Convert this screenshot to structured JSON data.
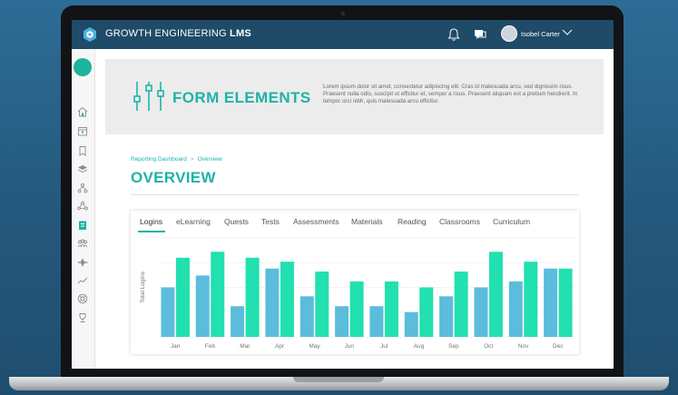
{
  "header": {
    "title_main": "GROWTH ENGINEERING",
    "title_bold": "LMS",
    "user_name": "Isobel Carter"
  },
  "icons": {
    "logo": "hexagon-logo-icon",
    "notifications": "bell-icon",
    "messages": "chat-icon",
    "user_menu": "chevron-down-icon",
    "sidebar": [
      "home-icon",
      "calendar-icon",
      "bookmark-icon",
      "layers-icon",
      "hierarchy-icon",
      "network-icon",
      "clipboard-icon",
      "group-icon",
      "compass-icon",
      "trend-icon",
      "lifebuoy-icon",
      "trophy-icon"
    ]
  },
  "banner": {
    "title": "FORM ELEMENTS",
    "description": "Lorem ipsum dolor sit amet, consectetur adipiscing elit. Cras id malesuada arcu, sed dignissim risus. Praesent nulla odio, suscipit ut efficitur et, semper a risus. Praesent aliquam est a pretium hendrerit. In tempor orci nibh, quis malesuada arcu efficitur."
  },
  "breadcrumb": {
    "parent": "Reporting Dashboard",
    "current": "Overview"
  },
  "page_title": "OVERVIEW",
  "tabs": [
    "Logins",
    "eLearning",
    "Quests",
    "Tests",
    "Assessments",
    "Materials",
    "Reading",
    "Classrooms",
    "Curriculum"
  ],
  "active_tab": "Logins",
  "colors": {
    "accent": "#1fb2a8",
    "header": "#1f4a68",
    "series_a": "#5bbcdc",
    "series_b": "#22e0b0"
  },
  "chart_data": {
    "type": "bar",
    "ylabel": "Total Logins",
    "categories": [
      "Jan",
      "Feb",
      "Mar",
      "Apr",
      "May",
      "Jun",
      "Jul",
      "Aug",
      "Sep",
      "Oct",
      "Nov",
      "Dec"
    ],
    "series": [
      {
        "values": [
          50,
          62,
          31,
          69,
          41,
          31,
          31,
          25,
          41,
          50,
          56,
          69
        ]
      },
      {
        "values": [
          80,
          86,
          80,
          76,
          66,
          56,
          56,
          50,
          66,
          86,
          76,
          69
        ]
      }
    ],
    "ylim": [
      0,
      100
    ],
    "grid": true,
    "legend": "none"
  }
}
